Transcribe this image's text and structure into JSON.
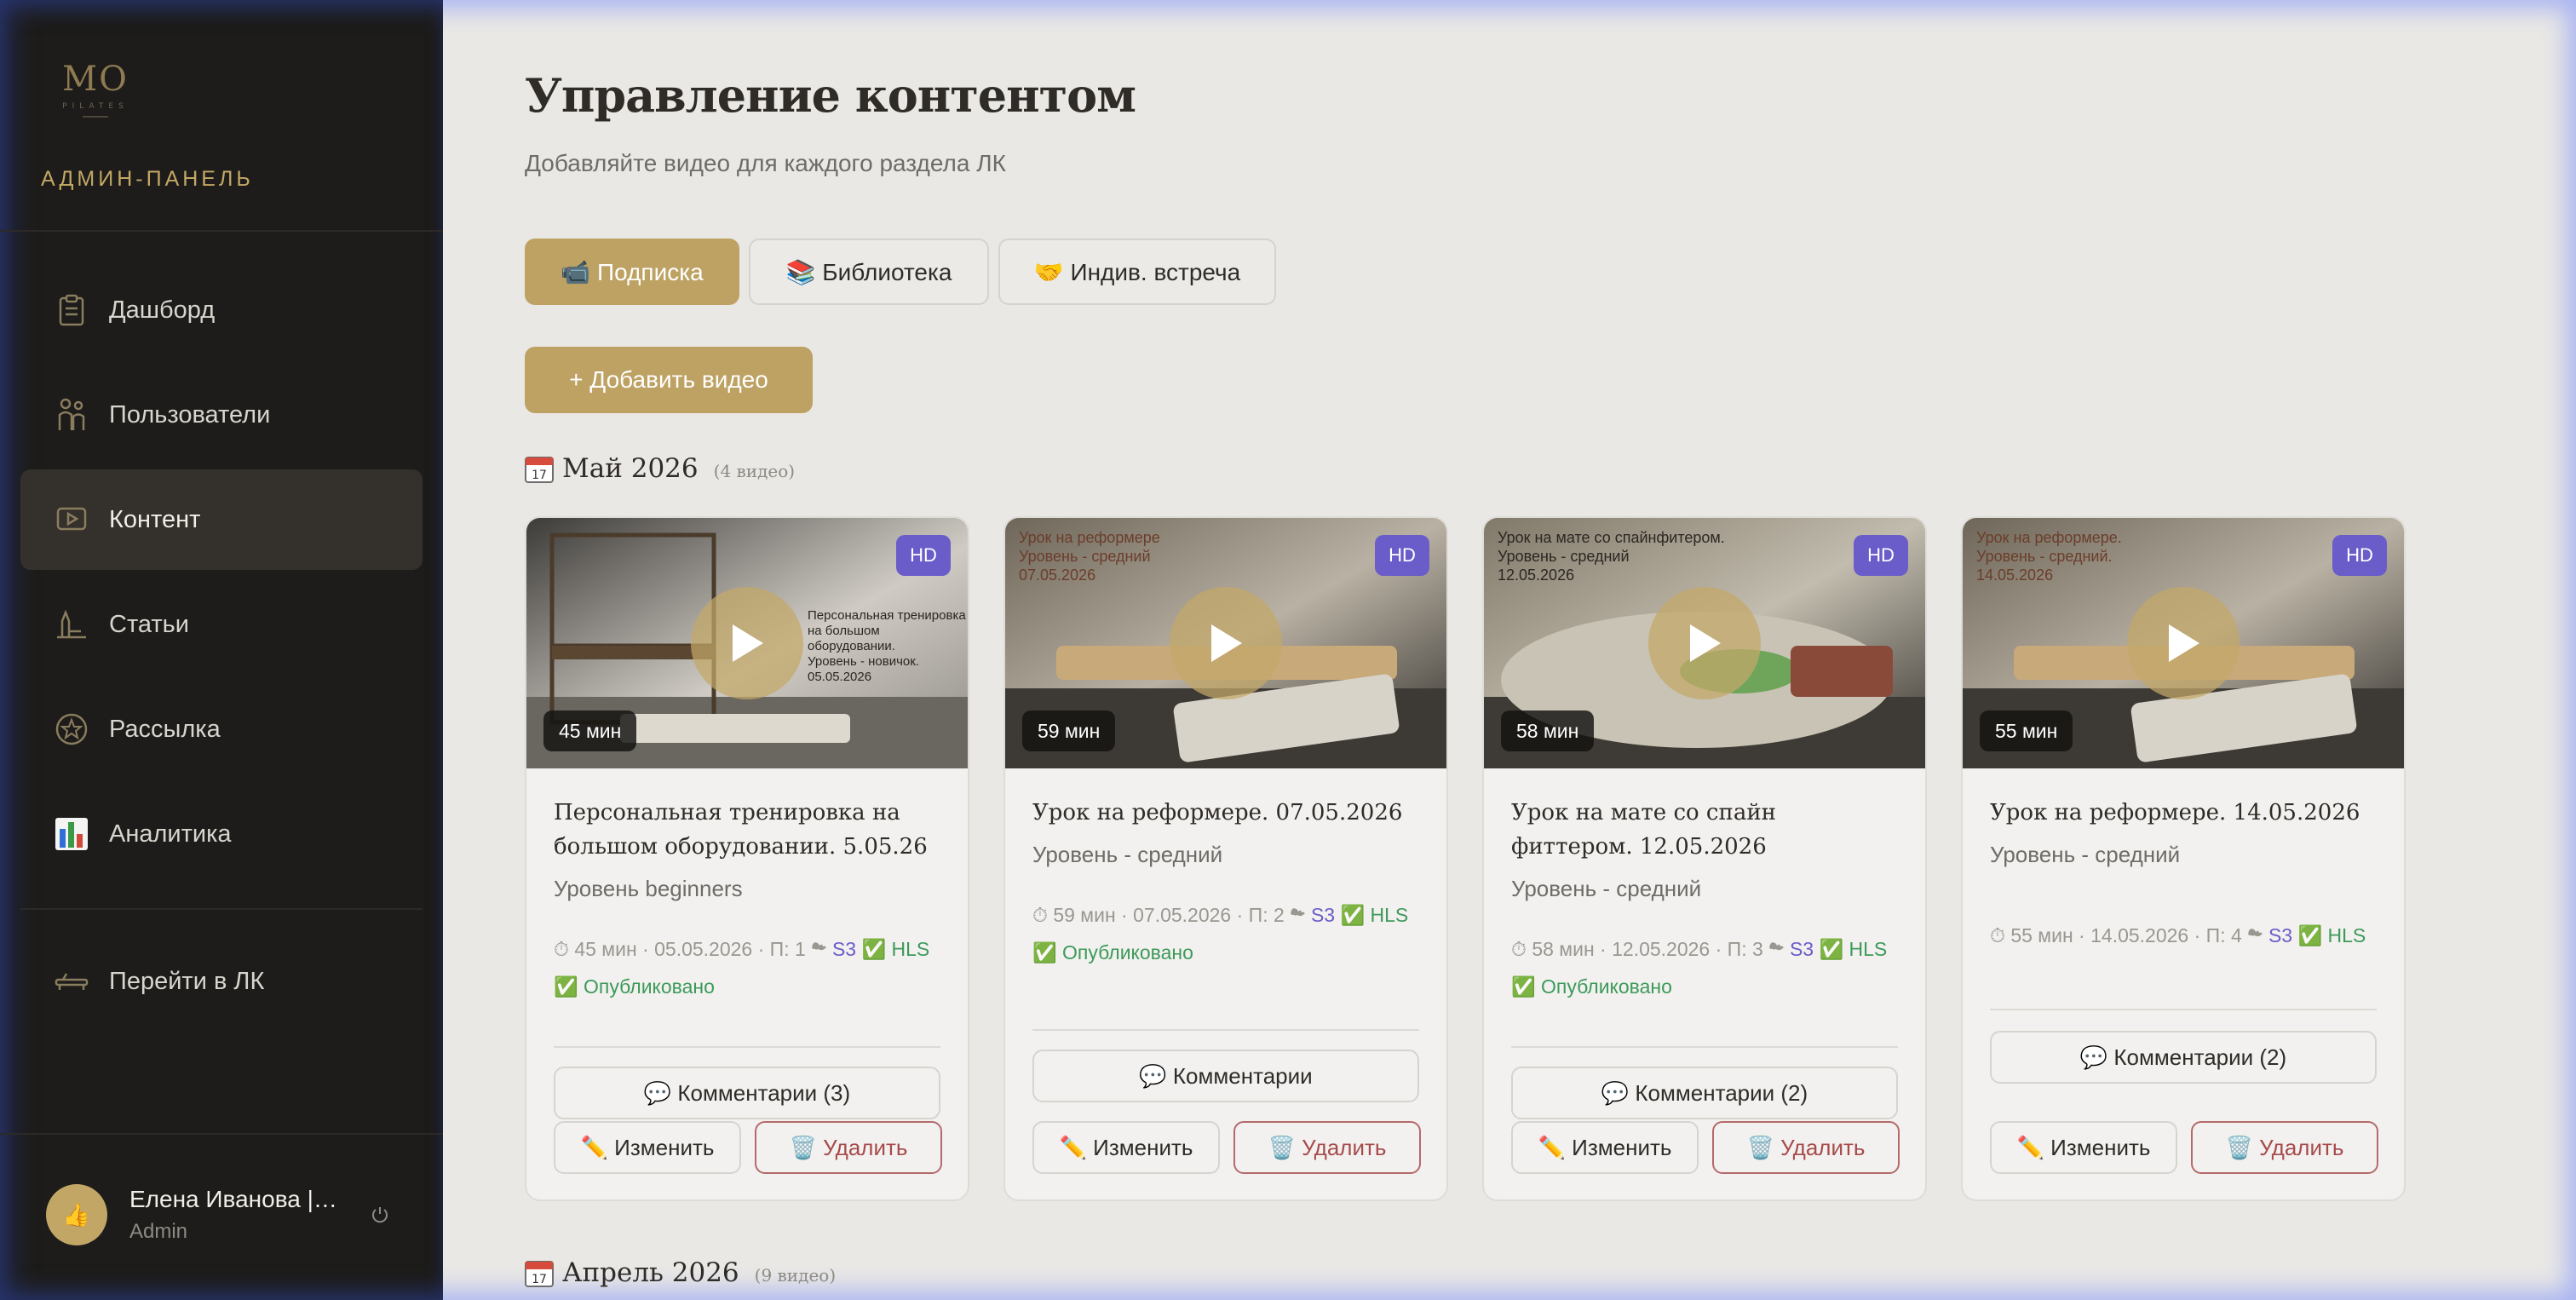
{
  "sidebar": {
    "logo_text": "MO",
    "logo_sub": "PILATES",
    "admin_title": "АДМИН-ПАНЕЛЬ",
    "items": [
      {
        "label": "Дашборд",
        "icon": "clipboard-icon"
      },
      {
        "label": "Пользователи",
        "icon": "users-icon"
      },
      {
        "label": "Контент",
        "icon": "video-icon",
        "active": true
      },
      {
        "label": "Статьи",
        "icon": "article-icon"
      },
      {
        "label": "Рассылка",
        "icon": "star-badge-icon"
      },
      {
        "label": "Аналитика",
        "icon": "bar-chart-icon"
      }
    ],
    "go_lk": "Перейти в ЛК",
    "user": {
      "name": "Елена Иванова | ...",
      "role": "Admin",
      "avatar_emoji": "👍"
    }
  },
  "main": {
    "title": "Управление контентом",
    "subtitle": "Добавляйте видео для каждого раздела ЛК",
    "tabs": [
      {
        "label": "📹 Подписка",
        "active": true
      },
      {
        "label": "📚 Библиотека"
      },
      {
        "label": "🤝 Индив. встреча"
      }
    ],
    "add_button": "+ Добавить видео"
  },
  "sections": [
    {
      "title": "Май 2026",
      "count": "(4 видео)"
    },
    {
      "title": "Апрель 2026",
      "count": "(9 видео)"
    }
  ],
  "cards": [
    {
      "hd": "HD",
      "duration": "45 мин",
      "caption": "Персональная тренировка\nна большом оборудовании.\nУровень - новичок.\n05.05.2026",
      "title": "Персональная тренировка на большом оборудовании. 5.05.26",
      "level": "Уровень beginners",
      "meta": "⏱ 45 мин · 05.05.2026 · П: 1 ☁",
      "s3": "S3",
      "hls": "✅ HLS",
      "status": "✅ Опубликовано",
      "comments": "💬 Комментарии (3)",
      "edit": "✏️ Изменить",
      "delete": "🗑️ Удалить"
    },
    {
      "hd": "HD",
      "duration": "59 мин",
      "caption": "Урок на реформере\nУровень - средний\n07.05.2026",
      "title": "Урок на реформере. 07.05.2026",
      "level": "Уровень - средний",
      "meta": "⏱ 59 мин · 07.05.2026 · П: 2 ☁",
      "s3": "S3",
      "hls": "✅ HLS",
      "status": "✅ Опубликовано",
      "comments": "💬 Комментарии",
      "edit": "✏️ Изменить",
      "delete": "🗑️ Удалить"
    },
    {
      "hd": "HD",
      "duration": "58 мин",
      "caption": "Урок на мате со спайнфитером.\nУровень - средний\n12.05.2026",
      "title": "Урок на мате со спайн фиттером. 12.05.2026",
      "level": "Уровень - средний",
      "meta": "⏱ 58 мин · 12.05.2026 · П: 3 ☁",
      "s3": "S3",
      "hls": "✅ HLS",
      "status": "✅ Опубликовано",
      "comments": "💬 Комментарии (2)",
      "edit": "✏️ Изменить",
      "delete": "🗑️ Удалить"
    },
    {
      "hd": "HD",
      "duration": "55 мин",
      "caption": "Урок на реформере.\nУровень - средний.\n14.05.2026",
      "title": "Урок на реформере. 14.05.2026",
      "level": "Уровень - средний",
      "meta": "⏱ 55 мин · 14.05.2026 · П: 4 ☁",
      "s3": "S3",
      "hls": "✅ HLS",
      "status": "",
      "comments": "💬 Комментарии (2)",
      "edit": "✏️ Изменить",
      "delete": "🗑️ Удалить"
    }
  ],
  "colors": {
    "accent": "#bda263",
    "sidebar_bg": "#1d1c1a",
    "page_bg": "#e9e8e5",
    "hd_badge": "#6a5cc9",
    "success": "#3d9a5a",
    "danger": "#a74a4a"
  }
}
